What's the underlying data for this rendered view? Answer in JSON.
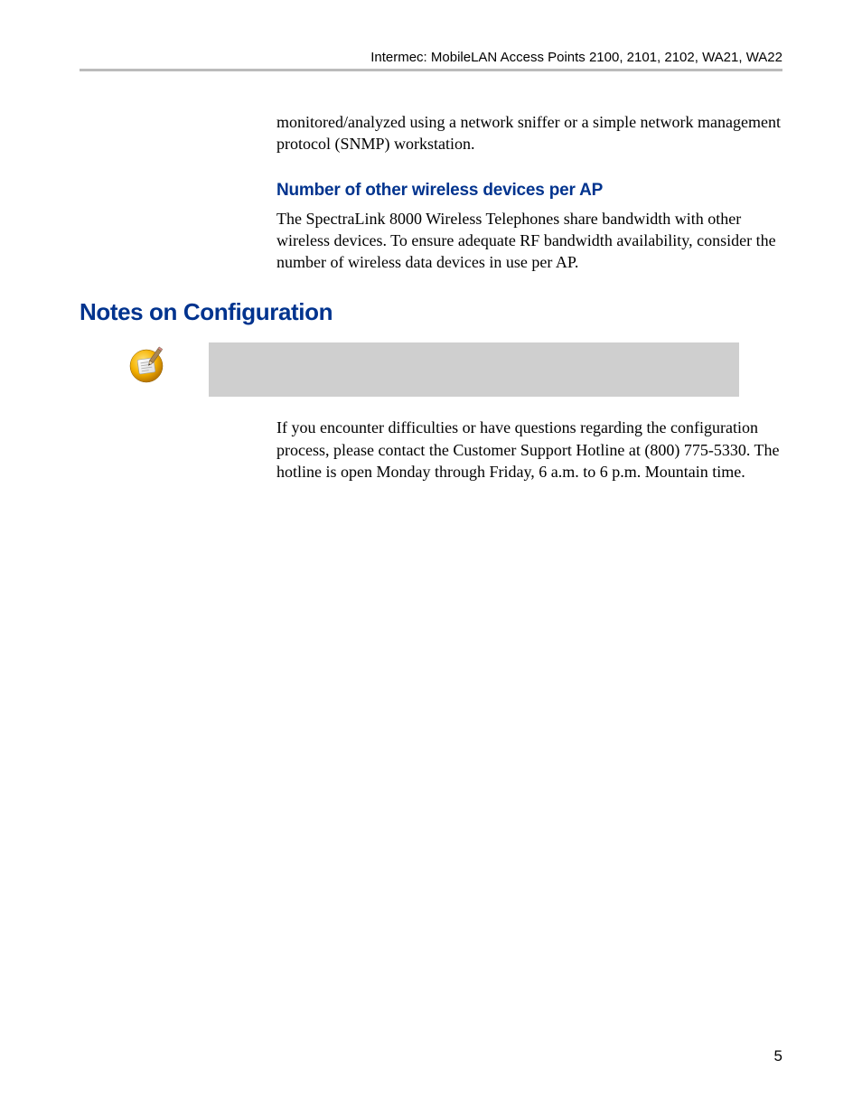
{
  "header": {
    "running_head": "Intermec: MobileLAN Access Points 2100, 2101, 2102, WA21, WA22"
  },
  "intro": {
    "paragraph1": "monitored/analyzed using a network sniffer or a simple network management protocol (SNMP) workstation."
  },
  "subsection": {
    "heading": "Number of other wireless devices per AP",
    "paragraph": "The SpectraLink 8000 Wireless Telephones share bandwidth with other wireless devices. To ensure adequate RF bandwidth availability, consider the number of wireless data devices in use per AP."
  },
  "section": {
    "heading": "Notes on Configuration",
    "note_icon": "notepad-pencil-icon",
    "paragraph": "If you encounter difficulties or have questions regarding the configuration process, please contact the Customer Support Hotline at (800) 775-5330. The hotline is open Monday through Friday, 6 a.m. to 6 p.m. Mountain time."
  },
  "footer": {
    "page_number": "5"
  }
}
